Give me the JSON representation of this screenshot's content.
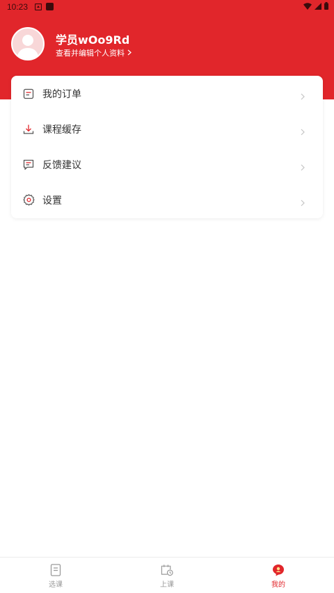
{
  "status_bar": {
    "time": "10:23"
  },
  "profile": {
    "username": "学员wOo9Rd",
    "edit_link": "查看并编辑个人资料"
  },
  "menu": {
    "items": [
      {
        "label": "我的订单",
        "icon": "order-icon"
      },
      {
        "label": "课程缓存",
        "icon": "download-icon"
      },
      {
        "label": "反馈建议",
        "icon": "feedback-icon"
      },
      {
        "label": "设置",
        "icon": "gear-icon"
      }
    ]
  },
  "tab_bar": {
    "tabs": [
      {
        "label": "选课",
        "icon": "book-icon",
        "active": false
      },
      {
        "label": "上课",
        "icon": "calendar-clock-icon",
        "active": false
      },
      {
        "label": "我的",
        "icon": "profile-badge-icon",
        "active": true
      }
    ]
  },
  "colors": {
    "brand": "#e1262b",
    "text_primary": "#333333",
    "text_inactive": "#9a9a9a"
  }
}
